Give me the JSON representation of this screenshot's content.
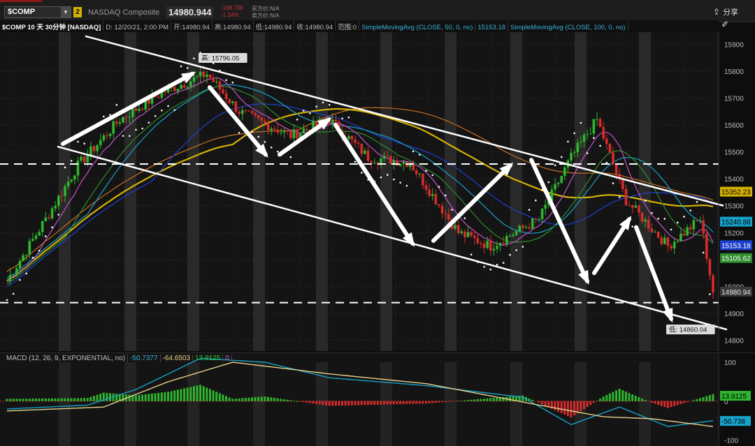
{
  "toolbar": {
    "symbol": "$COMP",
    "link_number": "2",
    "description": "NASDAQ Composite",
    "last_price": "14980.944",
    "change_abs": "-188.738",
    "change_pct": "-1.24%",
    "bid": "买方价:N/A",
    "ask": "卖方价:N/A",
    "share_label": "分享",
    "share_icon": "share-icon"
  },
  "infobar": {
    "title": "$COMP 10 天 30分钟 [NASDAQ]",
    "date": "D: 12/20/21, 2:00 PM",
    "open": "开:14980.94",
    "high": "高:14980.94",
    "low": "低:14980.94",
    "close": "收:14980.94",
    "range": "范围:0",
    "sma50": "SimpleMovingAvg (CLOSE, 50, 0, no)",
    "sma50_value": "15153.18",
    "sma100": "SimpleMovingAvg (CLOSE, 100, 0, no)",
    "sma100_value": "15352.23"
  },
  "chart": {
    "price_axis": [
      15900,
      15800,
      15700,
      15600,
      15500,
      15400,
      15300,
      15200,
      15100,
      15000,
      14900,
      14800
    ],
    "y_range": [
      14760,
      15945
    ],
    "high_label": "高: 15796.05",
    "low_label": "低: 14860.04",
    "price_tags": [
      {
        "text": "15352.23",
        "value": 15352.23,
        "bg": "#d4b106",
        "fg": "#000000"
      },
      {
        "text": "15240.88",
        "value": 15240.88,
        "bg": "#17a2c8",
        "fg": "#000000"
      },
      {
        "text": "15153.18",
        "value": 15153.18,
        "bg": "#1c3fcc",
        "fg": "#ffffff"
      },
      {
        "text": "15105.62",
        "value": 15105.62,
        "bg": "#2e8b2e",
        "fg": "#ffffff"
      },
      {
        "text": "14980.94",
        "value": 14980.94,
        "bg": "#3a3a3a",
        "fg": "#e6e6e6"
      }
    ],
    "colors": {
      "up": "#2fb52f",
      "down": "#d62c2c",
      "shade": "#3a3a3a",
      "sma100": "#d4b106",
      "sma50": "#2040d0",
      "cyan_ma": "#17a2c8",
      "green_ma": "#2e8b2e",
      "pink_ma": "#c850c8",
      "orange_ma": "#c87020"
    }
  },
  "macd": {
    "label": "MACD (12, 26, 9, EXPONENTIAL, no)",
    "value": "-50.7377",
    "avg": "-64.6503",
    "diff": "13.9125",
    "other": "0",
    "axis": [
      100,
      0,
      -100
    ],
    "tags": [
      {
        "text": "13.9125",
        "value": 13.9125,
        "bg": "#2fb52f",
        "fg": "#000000"
      },
      {
        "text": "-50.738",
        "value": -50.738,
        "bg": "#17a2c8",
        "fg": "#000000"
      }
    ]
  }
}
